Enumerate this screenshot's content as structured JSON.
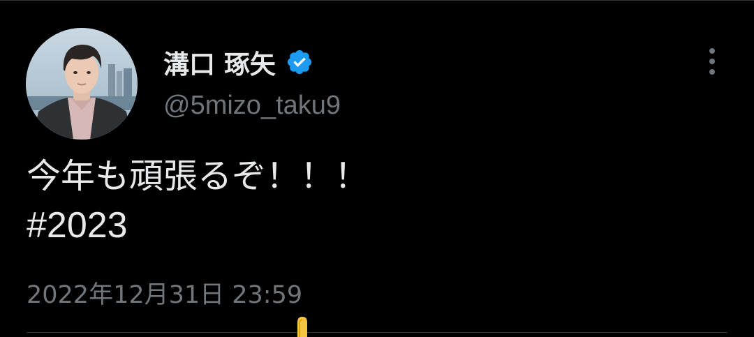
{
  "tweet": {
    "author": {
      "display_name": "溝口 琢矢",
      "handle": "@5mizo_taku9",
      "verified": true,
      "avatar": "profile-photo"
    },
    "text_line": "今年も頑張るぞ！！！",
    "hashtag": "#2023",
    "timestamp": "2022年12月31日 23:59"
  },
  "icons": {
    "verified": "verified-badge-icon",
    "more": "more-options-icon"
  },
  "colors": {
    "background": "#000000",
    "text_primary": "#e7e9ea",
    "text_secondary": "#71767b",
    "verified_blue": "#1d9bf0",
    "divider": "#2f3336"
  }
}
